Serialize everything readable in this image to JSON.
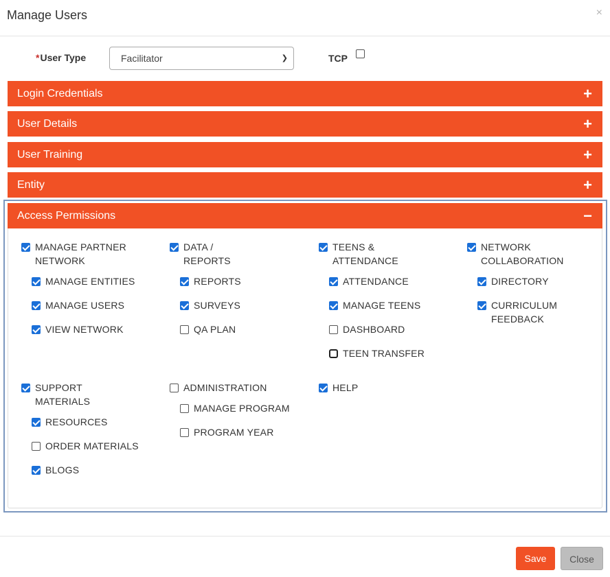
{
  "modal": {
    "title": "Manage Users",
    "close_glyph": "×"
  },
  "form": {
    "user_type_required": "*",
    "user_type_label": "User Type",
    "user_type_value": "Facilitator",
    "tcp_label": "TCP",
    "tcp_checked": false
  },
  "sections": [
    {
      "label": "Login Credentials",
      "sign": "+",
      "expanded": false
    },
    {
      "label": "User Details",
      "sign": "+",
      "expanded": false
    },
    {
      "label": "User Training",
      "sign": "+",
      "expanded": false
    },
    {
      "label": "Entity",
      "sign": "+",
      "expanded": false
    },
    {
      "label": "Access Permissions",
      "sign": "−",
      "expanded": true
    }
  ],
  "permissions": {
    "manage_partner_network": {
      "line1": "MANAGE PARTNER",
      "line2": "NETWORK",
      "checked": true
    },
    "manage_entities": {
      "label": "MANAGE ENTITIES",
      "checked": true
    },
    "manage_users": {
      "label": "MANAGE USERS",
      "checked": true
    },
    "view_network": {
      "label": "VIEW NETWORK",
      "checked": true
    },
    "data_reports": {
      "line1": "DATA /",
      "line2": "REPORTS",
      "checked": true
    },
    "reports": {
      "label": "REPORTS",
      "checked": true
    },
    "surveys": {
      "label": "SURVEYS",
      "checked": true
    },
    "qa_plan": {
      "label": "QA PLAN",
      "checked": false
    },
    "teens_attendance": {
      "line1": "TEENS &",
      "line2": "ATTENDANCE",
      "checked": true
    },
    "attendance": {
      "label": "ATTENDANCE",
      "checked": true
    },
    "manage_teens": {
      "label": "MANAGE TEENS",
      "checked": true
    },
    "dashboard": {
      "label": "DASHBOARD",
      "checked": false
    },
    "teen_transfer": {
      "label": "TEEN TRANSFER",
      "checked": false
    },
    "network_collaboration": {
      "line1": "NETWORK",
      "line2": "COLLABORATION",
      "checked": true
    },
    "directory": {
      "label": "DIRECTORY",
      "checked": true
    },
    "curriculum_feedback": {
      "line1": "CURRICULUM",
      "line2": "FEEDBACK",
      "checked": true
    },
    "support_materials": {
      "line1": "SUPPORT",
      "line2": "MATERIALS",
      "checked": true
    },
    "resources": {
      "label": "RESOURCES",
      "checked": true
    },
    "order_materials": {
      "label": "ORDER MATERIALS",
      "checked": false
    },
    "blogs": {
      "label": "BLOGS",
      "checked": true
    },
    "administration": {
      "label": "ADMINISTRATION",
      "checked": false
    },
    "manage_program": {
      "label": "MANAGE PROGRAM",
      "checked": false
    },
    "program_year": {
      "label": "PROGRAM YEAR",
      "checked": false
    },
    "help": {
      "label": "HELP",
      "checked": true
    }
  },
  "footer": {
    "save_label": "Save",
    "close_label": "Close"
  },
  "colors": {
    "accent": "#f15125",
    "checkbox": "#1a6fd8",
    "focus_frame": "#7b97bf"
  }
}
